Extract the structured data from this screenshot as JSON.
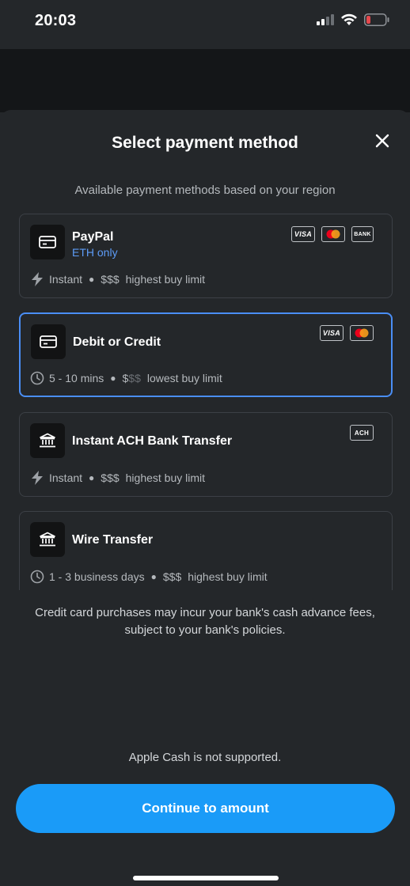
{
  "status_bar": {
    "time": "20:03"
  },
  "sheet": {
    "title": "Select payment method",
    "subtitle": "Available payment methods based on your region",
    "methods": [
      {
        "name": "PayPal",
        "sub": "ETH only",
        "icon": "card-icon",
        "speed_icon": "lightning-icon",
        "speed": "Instant",
        "cost_strong": "$$$",
        "cost_dim": "",
        "limit": "highest buy limit",
        "badges": [
          "VISA",
          "mastercard",
          "BANK"
        ],
        "selected": false
      },
      {
        "name": "Debit or Credit",
        "sub": "",
        "icon": "card-icon",
        "speed_icon": "clock-icon",
        "speed": "5 - 10 mins",
        "cost_strong": "$",
        "cost_dim": "$$",
        "limit": "lowest buy limit",
        "badges": [
          "VISA",
          "mastercard"
        ],
        "selected": true
      },
      {
        "name": "Instant ACH Bank Transfer",
        "sub": "",
        "icon": "bank-icon",
        "speed_icon": "lightning-icon",
        "speed": "Instant",
        "cost_strong": "$$$",
        "cost_dim": "",
        "limit": "highest buy limit",
        "badges": [
          "ACH"
        ],
        "selected": false
      },
      {
        "name": "Wire Transfer",
        "sub": "",
        "icon": "bank-icon",
        "speed_icon": "clock-icon",
        "speed": "1 - 3 business days",
        "cost_strong": "$$$",
        "cost_dim": "",
        "limit": "highest buy limit",
        "badges": [],
        "selected": false
      }
    ],
    "disclaimer": "Credit card purchases may incur your bank's cash advance fees, subject to your bank's policies."
  },
  "footer": {
    "note": "Apple Cash is not supported.",
    "cta_label": "Continue to amount"
  },
  "colors": {
    "accent": "#1a9bf8",
    "selected_border": "#4a8ef5",
    "eth_only": "#5d9cf7",
    "background": "#24272a"
  }
}
